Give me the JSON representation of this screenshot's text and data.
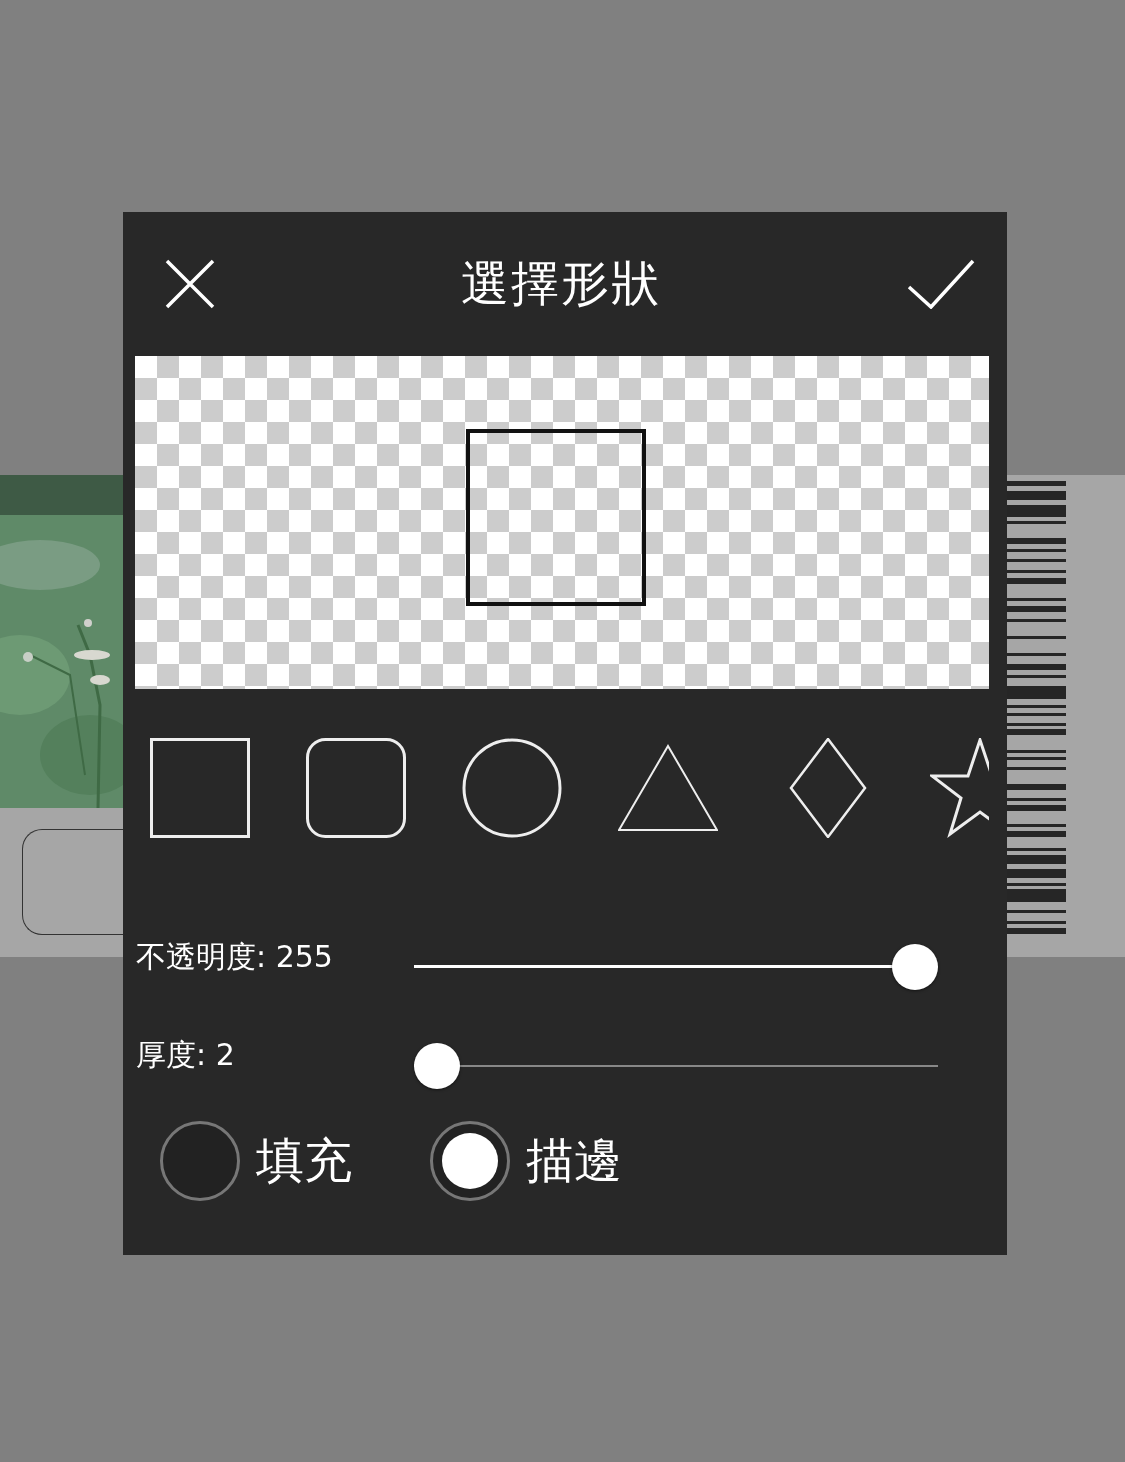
{
  "dialog": {
    "title": "選擇形狀",
    "preview": {
      "kind": "square"
    },
    "shapes": [
      {
        "kind": "square"
      },
      {
        "kind": "rounded"
      },
      {
        "kind": "circle"
      },
      {
        "kind": "triangle"
      },
      {
        "kind": "diamond"
      },
      {
        "kind": "star"
      }
    ],
    "sliders": [
      {
        "label": "不透明度: 255",
        "level": 1
      },
      {
        "label": "厚度: 2",
        "level": 0
      }
    ],
    "modes": [
      {
        "label": "填充",
        "selected": false
      },
      {
        "label": "描邊",
        "selected": true
      }
    ]
  }
}
